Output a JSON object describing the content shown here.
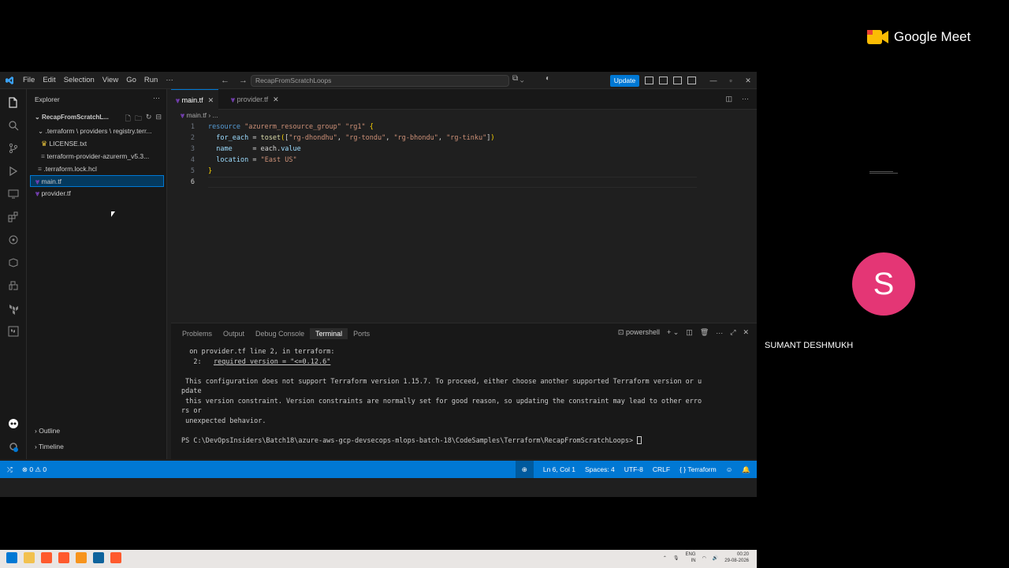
{
  "window": {
    "search_text": "RecapFromScratchLoops",
    "menu": [
      "File",
      "Edit",
      "Selection",
      "View",
      "Go",
      "Run",
      "···"
    ],
    "update_label": "Update"
  },
  "explorer": {
    "title": "Explorer",
    "folder": "RecapFromScratchL...",
    "items": [
      {
        "label": ".terraform \\ providers \\ registry.terr...",
        "icon": "chevron-down-icon"
      },
      {
        "label": "LICENSE.txt",
        "icon": "license-icon"
      },
      {
        "label": "terraform-provider-azurerm_v5.3...",
        "icon": "binary-file-icon"
      },
      {
        "label": ".terraform.lock.hcl",
        "icon": "file-icon"
      },
      {
        "label": "main.tf",
        "icon": "terraform-icon"
      },
      {
        "label": "provider.tf",
        "icon": "terraform-icon"
      }
    ],
    "outline": "Outline",
    "timeline": "Timeline"
  },
  "editor": {
    "tabs": [
      {
        "label": "main.tf",
        "active": true
      },
      {
        "label": "provider.tf",
        "active": false
      }
    ],
    "breadcrumb": [
      "main.tf",
      "..."
    ],
    "line_numbers": [
      "1",
      "2",
      "3",
      "4",
      "5",
      "6"
    ]
  },
  "panel": {
    "tabs": [
      "Problems",
      "Output",
      "Debug Console",
      "Terminal",
      "Ports"
    ],
    "active_tab": "Terminal",
    "shell": "powershell",
    "lines": [
      "  on provider.tf line 2, in terraform:",
      "   2:   required_version = \"<=0.12.6\"",
      "",
      " This configuration does not support Terraform version 1.15.7. To proceed, either choose another supported Terraform version or u",
      "pdate",
      " this version constraint. Version constraints are normally set for good reason, so updating the constraint may lead to other erro",
      "rs or",
      " unexpected behavior.",
      "",
      "PS C:\\DevOpsInsiders\\Batch18\\azure-aws-gcp-devsecops-mlops-batch-18\\CodeSamples\\Terraform\\RecapFromScratchLoops> "
    ]
  },
  "statusbar": {
    "problems": "0",
    "warnings": "0",
    "position": "Ln 6, Col 1",
    "spaces": "Spaces: 4",
    "encoding": "UTF-8",
    "eol": "CRLF",
    "language": "Terraform"
  },
  "taskbar": {
    "lang1": "ENG",
    "lang2": "IN",
    "time": "00:20",
    "date": "29-08-2026"
  },
  "meet": {
    "brand": "Google Meet",
    "participant_initial": "S",
    "participant_name": "SUMANT DESHMUKH",
    "avatar_color": "#e43675"
  }
}
